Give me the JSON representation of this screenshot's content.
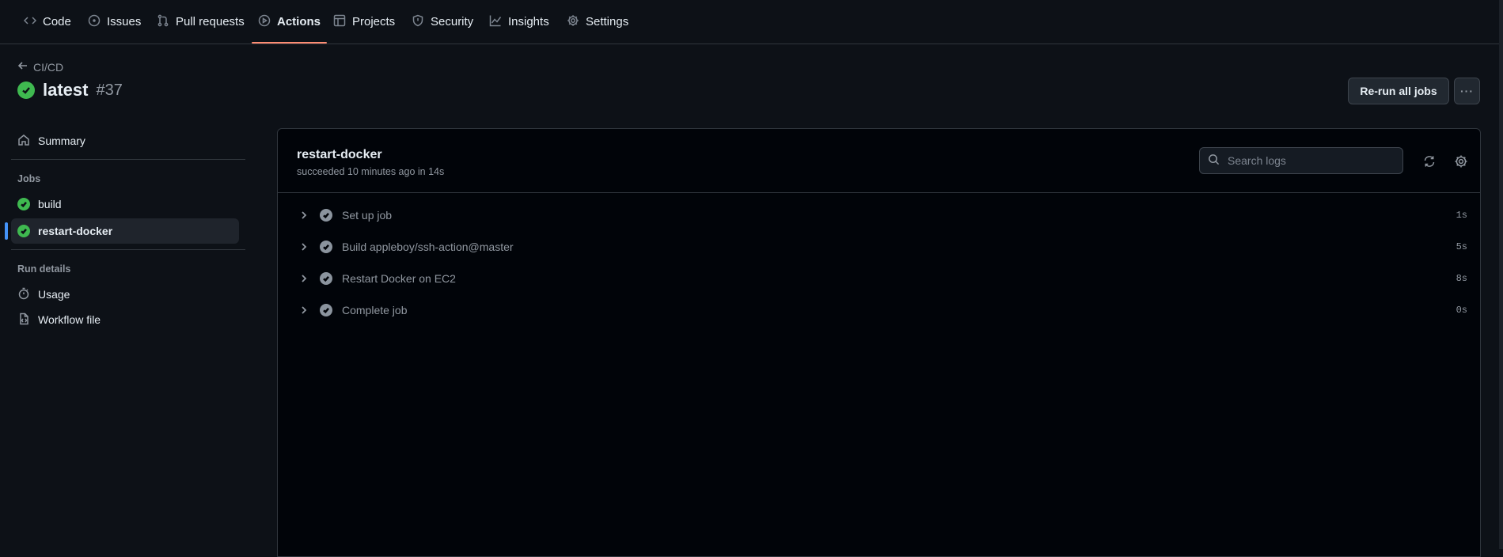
{
  "nav": {
    "tabs": [
      {
        "label": "Code",
        "icon": "code-icon"
      },
      {
        "label": "Issues",
        "icon": "issue-icon"
      },
      {
        "label": "Pull requests",
        "icon": "pull-request-icon"
      },
      {
        "label": "Actions",
        "icon": "play-icon",
        "active": true
      },
      {
        "label": "Projects",
        "icon": "table-icon"
      },
      {
        "label": "Security",
        "icon": "shield-icon"
      },
      {
        "label": "Insights",
        "icon": "graph-icon"
      },
      {
        "label": "Settings",
        "icon": "gear-icon"
      }
    ]
  },
  "header": {
    "back_label": "CI/CD",
    "run_name": "latest",
    "run_number": "#37",
    "rerun_label": "Re-run all jobs",
    "more_label": "···"
  },
  "sidebar": {
    "summary_label": "Summary",
    "jobs_heading": "Jobs",
    "jobs": [
      {
        "label": "build",
        "status": "success"
      },
      {
        "label": "restart-docker",
        "status": "success",
        "selected": true
      }
    ],
    "run_details_heading": "Run details",
    "details": [
      {
        "label": "Usage",
        "icon": "stopwatch-icon"
      },
      {
        "label": "Workflow file",
        "icon": "file-code-icon"
      }
    ]
  },
  "job": {
    "name": "restart-docker",
    "meta": "succeeded 10 minutes ago in 14s",
    "search_placeholder": "Search logs",
    "steps": [
      {
        "label": "Set up job",
        "duration": "1s"
      },
      {
        "label": "Build appleboy/ssh-action@master",
        "duration": "5s"
      },
      {
        "label": "Restart Docker on EC2",
        "duration": "8s"
      },
      {
        "label": "Complete job",
        "duration": "0s"
      }
    ]
  },
  "colors": {
    "background": "#0d1117",
    "success": "#3fb950",
    "active_tab_underline": "#fd8c73",
    "selected_indicator": "#4493f8"
  }
}
